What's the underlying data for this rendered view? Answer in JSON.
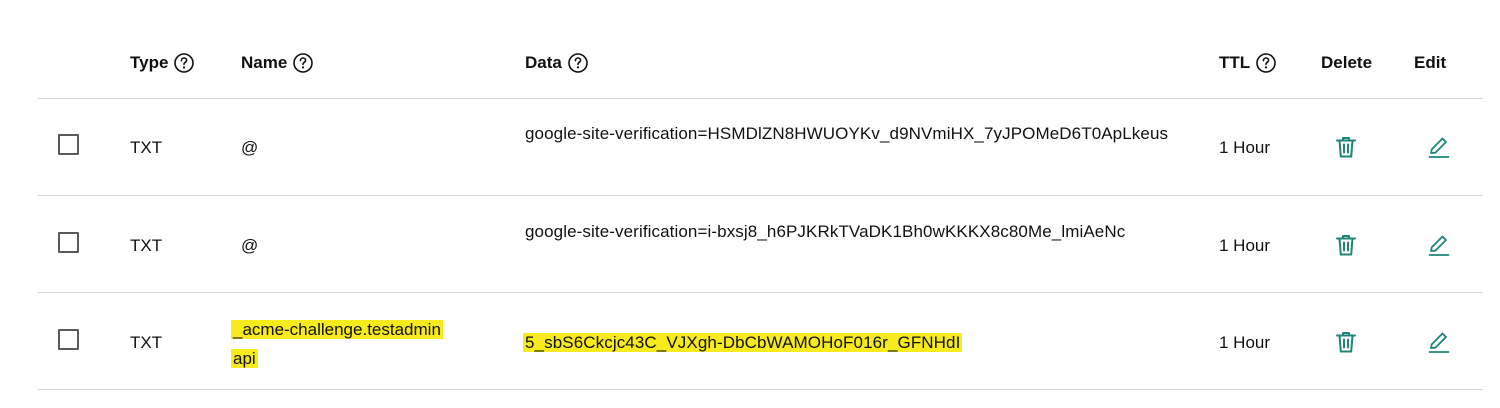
{
  "headers": {
    "type": "Type",
    "name": "Name",
    "data": "Data",
    "ttl": "TTL",
    "delete": "Delete",
    "edit": "Edit"
  },
  "records": [
    {
      "type": "TXT",
      "name": "@",
      "data": "google-site-verification=HSMDlZN8HWUOYKv_d9NVmiHX_7yJPOMeD6T0ApLkeus",
      "ttl": "1 Hour"
    },
    {
      "type": "TXT",
      "name": "@",
      "data": "google-site-verification=i-bxsj8_h6PJKRkTVaDK1Bh0wKKKX8c80Me_lmiAeNc",
      "ttl": "1 Hour"
    },
    {
      "type": "TXT",
      "name_line1": "_acme-challenge.testadmin",
      "name_line2": "api",
      "data": "5_sbS6Ckcjc43C_VJXgh-DbCbWAMOHoF016r_GFNHdI",
      "ttl": "1 Hour"
    }
  ],
  "colors": {
    "icon_accent": "#1e8577",
    "highlight": "#f7ea1d",
    "divider": "#d6d6d6"
  },
  "icons": {
    "help": "question-circle-icon",
    "delete": "trash-icon",
    "edit": "pencil-icon"
  }
}
